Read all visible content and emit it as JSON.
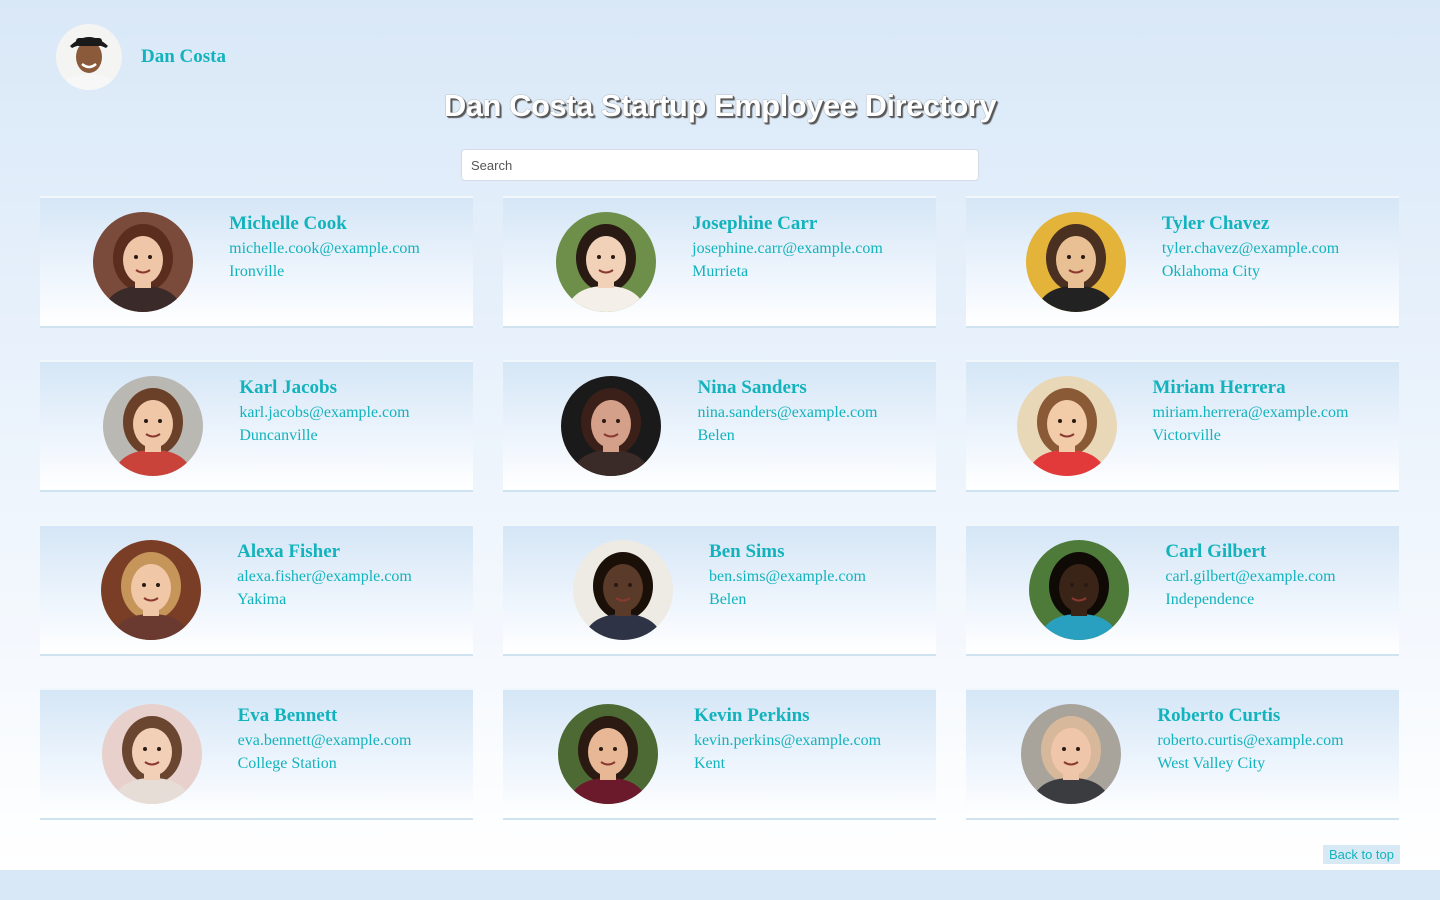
{
  "header": {
    "user_name": "Dan Costa",
    "title": "Dan Costa Startup Employee Directory"
  },
  "search": {
    "placeholder": "Search",
    "value": ""
  },
  "employees": [
    {
      "name": "Michelle Cook",
      "email": "michelle.cook@example.com",
      "city": "Ironville",
      "skin": "#f0c6a8",
      "hair": "#5a2d1e",
      "bg": "#7a4a3a",
      "shirt": "#3b2a2a"
    },
    {
      "name": "Josephine Carr",
      "email": "josephine.carr@example.com",
      "city": "Murrieta",
      "skin": "#f1d2b8",
      "hair": "#2a1a14",
      "bg": "#6d8f4a",
      "shirt": "#f4efe9"
    },
    {
      "name": "Tyler Chavez",
      "email": "tyler.chavez@example.com",
      "city": "Oklahoma City",
      "skin": "#e9bf94",
      "hair": "#4a3020",
      "bg": "#e3b33a",
      "shirt": "#222222"
    },
    {
      "name": "Karl Jacobs",
      "email": "karl.jacobs@example.com",
      "city": "Duncanville",
      "skin": "#f0c8a8",
      "hair": "#6a4028",
      "bg": "#b9b8b3",
      "shirt": "#c9433b"
    },
    {
      "name": "Nina Sanders",
      "email": "nina.sanders@example.com",
      "city": "Belen",
      "skin": "#d4a08a",
      "hair": "#3a2018",
      "bg": "#1a1a1a",
      "shirt": "#3a2a28"
    },
    {
      "name": "Miriam Herrera",
      "email": "miriam.herrera@example.com",
      "city": "Victorville",
      "skin": "#f2cba8",
      "hair": "#8a5a36",
      "bg": "#e8d8b8",
      "shirt": "#e23a3a"
    },
    {
      "name": "Alexa Fisher",
      "email": "alexa.fisher@example.com",
      "city": "Yakima",
      "skin": "#f0c8a8",
      "hair": "#c6955a",
      "bg": "#7a3e26",
      "shirt": "#6a3a30"
    },
    {
      "name": "Ben Sims",
      "email": "ben.sims@example.com",
      "city": "Belen",
      "skin": "#5a3a28",
      "hair": "#1a1008",
      "bg": "#eeeae4",
      "shirt": "#2e3446"
    },
    {
      "name": "Carl Gilbert",
      "email": "carl.gilbert@example.com",
      "city": "Independence",
      "skin": "#3a2418",
      "hair": "#100a06",
      "bg": "#4e7a3a",
      "shirt": "#2aa0c0"
    },
    {
      "name": "Eva Bennett",
      "email": "eva.bennett@example.com",
      "city": "College Station",
      "skin": "#f2d0b8",
      "hair": "#6a4630",
      "bg": "#e8d0cc",
      "shirt": "#e6ddd6"
    },
    {
      "name": "Kevin Perkins",
      "email": "kevin.perkins@example.com",
      "city": "Kent",
      "skin": "#e8b896",
      "hair": "#2a1a12",
      "bg": "#4e6a34",
      "shirt": "#6a1a2a"
    },
    {
      "name": "Roberto Curtis",
      "email": "roberto.curtis@example.com",
      "city": "West Valley City",
      "skin": "#f0c6aa",
      "hair": "#d8b89a",
      "bg": "#a8a49c",
      "shirt": "#3a3c40"
    }
  ],
  "footer": {
    "back_to_top": "Back to top"
  }
}
